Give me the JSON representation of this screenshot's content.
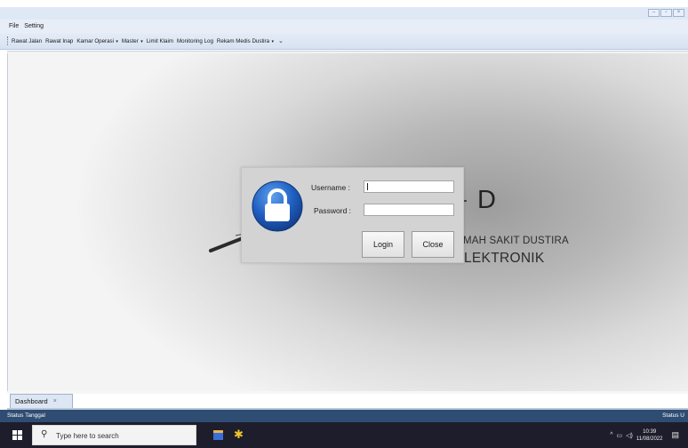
{
  "window": {
    "buttons": [
      "minimize-icon",
      "maximize-icon",
      "close-icon"
    ]
  },
  "menu": {
    "items": [
      "File",
      "Setting"
    ]
  },
  "toolbar": {
    "items": [
      {
        "label": "Rawat Jalan"
      },
      {
        "label": "Rawat Inap"
      },
      {
        "label": "Kamar Operasi",
        "dropdown": true
      },
      {
        "label": "Master",
        "dropdown": true
      },
      {
        "label": "Limit Klaim"
      },
      {
        "label": "Monitoring Log"
      },
      {
        "label": "Rekam Medis Dustira",
        "dropdown": true
      }
    ],
    "overflow": "chevron-down-icon"
  },
  "background": {
    "letter": "D",
    "line1": "MAH SAKIT DUSTIRA",
    "line2": "LEKTRONIK"
  },
  "login": {
    "username_label": "Username :",
    "password_label": "Password :",
    "username_value": "",
    "password_value": "",
    "login_button": "Login",
    "close_button": "Close",
    "icon": "padlock-icon"
  },
  "tabs": [
    {
      "label": "Dashboard",
      "close": "×"
    }
  ],
  "status": {
    "left": "Status Tanggal",
    "right": "Status U"
  },
  "taskbar": {
    "search_placeholder": "Type here to search",
    "time": "10:39",
    "date": "11/08/2022",
    "tray_arrow": "^",
    "colors": {
      "taskbar": "#1d1d2b",
      "statusbar": "#2f4c72"
    }
  }
}
